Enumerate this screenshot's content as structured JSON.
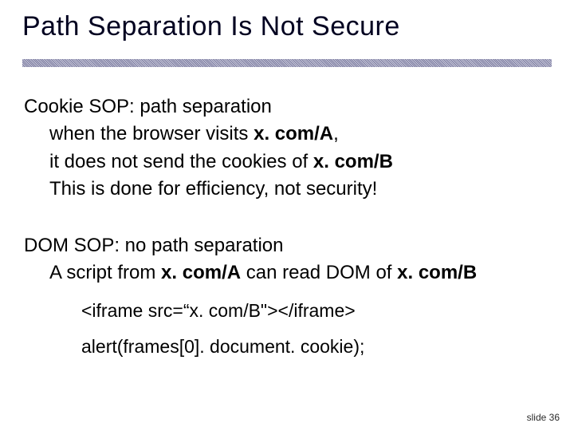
{
  "title": "Path Separation Is Not Secure",
  "section1": {
    "heading": "Cookie SOP: path separation",
    "l1a": "when the browser visits ",
    "l1b": "x. com/A",
    "l1c": ",",
    "l2a": "it does not send the cookies of ",
    "l2b": "x. com/B",
    "l3": "This is done for efficiency, not security!"
  },
  "section2": {
    "heading": "DOM SOP: no path separation",
    "l1a": "A script from ",
    "l1b": "x. com/A",
    "l1c": " can read DOM of ",
    "l1d": "x. com/B"
  },
  "code": {
    "line1": "<iframe src=“x. com/B\"></iframe>",
    "line2": "alert(frames[0]. document. cookie);"
  },
  "footer": "slide 36"
}
